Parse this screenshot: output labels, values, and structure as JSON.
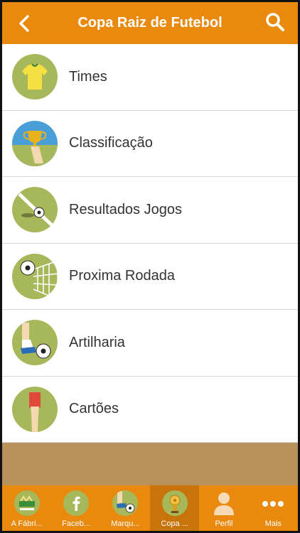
{
  "header": {
    "title": "Copa Raiz de Futebol",
    "back_icon": "chevron-left-icon",
    "search_icon": "search-icon"
  },
  "menu": [
    {
      "label": "Times",
      "icon": "jersey-icon"
    },
    {
      "label": "Classificação",
      "icon": "trophy-icon"
    },
    {
      "label": "Resultados Jogos",
      "icon": "ball-on-field-icon"
    },
    {
      "label": "Proxima Rodada",
      "icon": "ball-in-net-icon"
    },
    {
      "label": "Artilharia",
      "icon": "kicking-player-icon"
    },
    {
      "label": "Cartões",
      "icon": "red-card-icon"
    }
  ],
  "tabs": [
    {
      "label": "A Fábri...",
      "icon": "fabrica-logo-icon"
    },
    {
      "label": "Faceb...",
      "icon": "facebook-icon"
    },
    {
      "label": "Marqu...",
      "icon": "kick-icon"
    },
    {
      "label": "Copa ...",
      "icon": "cup-icon",
      "active": true
    },
    {
      "label": "Perfil",
      "icon": "profile-icon"
    },
    {
      "label": "Mais",
      "icon": "more-icon"
    }
  ],
  "colors": {
    "accent": "#e98a0f",
    "accent_active": "#c9740b",
    "icon_circle": "#a7b85a",
    "filler": "#b8925a"
  }
}
